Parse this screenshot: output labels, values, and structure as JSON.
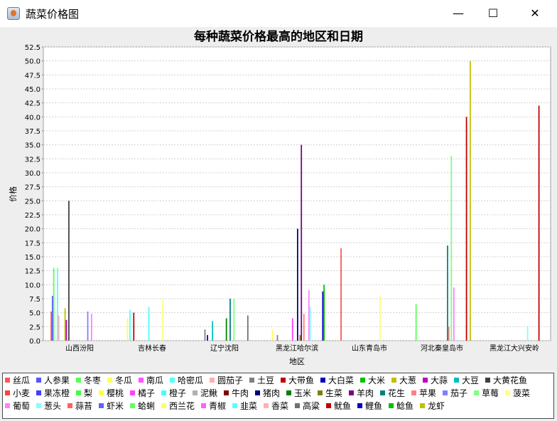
{
  "window": {
    "title": "蔬菜价格图",
    "minimize_symbol": "—",
    "maximize_symbol": "☐",
    "close_symbol": "✕"
  },
  "chart_data": {
    "type": "bar",
    "title": "每种蔬菜价格最高的地区和日期",
    "xlabel": "地区",
    "ylabel": "价格",
    "ylim": [
      0,
      52.5
    ],
    "ytick_step": 2.5,
    "grid": true,
    "legend_position": "bottom",
    "categories": [
      "山西汾阳",
      "吉林长春",
      "辽宁沈阳",
      "黑龙江哈尔滨",
      "山东青岛市",
      "河北秦皇岛市",
      "黑龙江大兴安岭"
    ],
    "series": [
      {
        "name": "丝瓜",
        "color": "#ff5555",
        "values": [
          5.2,
          null,
          null,
          null,
          16.5,
          null,
          null
        ]
      },
      {
        "name": "人参果",
        "color": "#5555ff",
        "values": [
          8.0,
          null,
          null,
          null,
          null,
          null,
          null
        ]
      },
      {
        "name": "冬枣",
        "color": "#55ff55",
        "values": [
          13.0,
          null,
          null,
          null,
          null,
          6.5,
          null
        ]
      },
      {
        "name": "冬瓜",
        "color": "#ffff55",
        "values": [
          null,
          4.0,
          null,
          2.0,
          null,
          null,
          null
        ]
      },
      {
        "name": "南瓜",
        "color": "#ff55ff",
        "values": [
          null,
          null,
          null,
          null,
          null,
          null,
          null
        ]
      },
      {
        "name": "哈密瓜",
        "color": "#55ffff",
        "values": [
          13.0,
          5.5,
          null,
          null,
          null,
          null,
          null
        ]
      },
      {
        "name": "圆茄子",
        "color": "#ffafaf",
        "values": [
          4.5,
          null,
          null,
          null,
          null,
          null,
          null
        ]
      },
      {
        "name": "土豆",
        "color": "#808080",
        "values": [
          null,
          null,
          2.0,
          1.0,
          null,
          null,
          null
        ]
      },
      {
        "name": "大带鱼",
        "color": "#c00000",
        "values": [
          null,
          5.0,
          null,
          null,
          null,
          null,
          null
        ]
      },
      {
        "name": "大白菜",
        "color": "#0000c0",
        "values": [
          null,
          null,
          1.0,
          null,
          null,
          null,
          null
        ]
      },
      {
        "name": "大米",
        "color": "#00c000",
        "values": [
          null,
          null,
          null,
          null,
          null,
          null,
          null
        ]
      },
      {
        "name": "大葱",
        "color": "#c0c000",
        "values": [
          5.8,
          null,
          null,
          null,
          null,
          null,
          null
        ]
      },
      {
        "name": "大蒜",
        "color": "#c000c0",
        "values": [
          3.7,
          null,
          null,
          null,
          null,
          null,
          null
        ]
      },
      {
        "name": "大豆",
        "color": "#00c0c0",
        "values": [
          null,
          null,
          3.5,
          null,
          null,
          null,
          null
        ]
      },
      {
        "name": "大黄花鱼",
        "color": "#404040",
        "values": [
          25.0,
          null,
          null,
          null,
          null,
          null,
          null
        ]
      },
      {
        "name": "小麦",
        "color": "#ff4040",
        "values": [
          null,
          null,
          null,
          null,
          null,
          null,
          null
        ]
      },
      {
        "name": "果冻橙",
        "color": "#4040ff",
        "values": [
          null,
          null,
          null,
          null,
          null,
          null,
          null
        ]
      },
      {
        "name": "梨",
        "color": "#40ff40",
        "values": [
          null,
          null,
          null,
          null,
          null,
          null,
          null
        ]
      },
      {
        "name": "樱桃",
        "color": "#ffff40",
        "values": [
          null,
          null,
          null,
          null,
          null,
          null,
          null
        ]
      },
      {
        "name": "橘子",
        "color": "#ff40ff",
        "values": [
          null,
          null,
          null,
          4.0,
          null,
          null,
          null
        ]
      },
      {
        "name": "橙子",
        "color": "#40ffff",
        "values": [
          null,
          6.0,
          null,
          null,
          null,
          null,
          null
        ]
      },
      {
        "name": "泥鳅",
        "color": "#b0b0b0",
        "values": [
          null,
          null,
          null,
          null,
          null,
          null,
          null
        ]
      },
      {
        "name": "牛肉",
        "color": "#800000",
        "values": [
          null,
          null,
          null,
          null,
          null,
          null,
          null
        ]
      },
      {
        "name": "猪肉",
        "color": "#000080",
        "values": [
          null,
          null,
          null,
          20.0,
          null,
          null,
          null
        ]
      },
      {
        "name": "玉米",
        "color": "#008000",
        "values": [
          null,
          null,
          4.0,
          null,
          null,
          null,
          null
        ]
      },
      {
        "name": "生菜",
        "color": "#808000",
        "values": [
          null,
          null,
          null,
          1.0,
          null,
          null,
          null
        ]
      },
      {
        "name": "羊肉",
        "color": "#800080",
        "values": [
          null,
          null,
          null,
          35.0,
          null,
          null,
          null
        ]
      },
      {
        "name": "花生",
        "color": "#008080",
        "values": [
          null,
          null,
          7.5,
          null,
          null,
          17.0,
          null
        ]
      },
      {
        "name": "苹果",
        "color": "#ff8080",
        "values": [
          null,
          null,
          null,
          4.8,
          null,
          2.5,
          null
        ]
      },
      {
        "name": "茄子",
        "color": "#8080ff",
        "values": [
          5.2,
          null,
          null,
          null,
          null,
          null,
          null
        ]
      },
      {
        "name": "草莓",
        "color": "#80ff80",
        "values": [
          null,
          null,
          7.5,
          null,
          null,
          33.0,
          null
        ]
      },
      {
        "name": "菠菜",
        "color": "#ffff80",
        "values": [
          null,
          7.5,
          null,
          null,
          8.0,
          null,
          null
        ]
      },
      {
        "name": "葡萄",
        "color": "#ff80ff",
        "values": [
          4.8,
          null,
          null,
          9.0,
          null,
          9.5,
          null
        ]
      },
      {
        "name": "葱头",
        "color": "#80ffff",
        "values": [
          null,
          null,
          null,
          6.0,
          null,
          null,
          2.5
        ]
      },
      {
        "name": "蒜苔",
        "color": "#ff6060",
        "values": [
          null,
          null,
          null,
          null,
          null,
          null,
          null
        ]
      },
      {
        "name": "虾米",
        "color": "#6060ff",
        "values": [
          null,
          null,
          null,
          null,
          null,
          null,
          null
        ]
      },
      {
        "name": "蛤蜊",
        "color": "#60ff60",
        "values": [
          null,
          null,
          null,
          null,
          null,
          null,
          null
        ]
      },
      {
        "name": "西兰花",
        "color": "#ffff60",
        "values": [
          null,
          null,
          null,
          null,
          null,
          null,
          null
        ]
      },
      {
        "name": "青椒",
        "color": "#ff60ff",
        "values": [
          null,
          null,
          null,
          null,
          null,
          null,
          null
        ]
      },
      {
        "name": "韭菜",
        "color": "#60ffff",
        "values": [
          null,
          null,
          null,
          null,
          null,
          null,
          null
        ]
      },
      {
        "name": "香菜",
        "color": "#ffb0b0",
        "values": [
          null,
          null,
          null,
          null,
          null,
          null,
          null
        ]
      },
      {
        "name": "高粱",
        "color": "#707070",
        "values": [
          null,
          null,
          4.5,
          null,
          null,
          null,
          null
        ]
      },
      {
        "name": "鱿鱼",
        "color": "#c00000",
        "values": [
          null,
          null,
          null,
          null,
          null,
          40.0,
          42.0
        ]
      },
      {
        "name": "鲤鱼",
        "color": "#0000c0",
        "values": [
          null,
          null,
          null,
          8.8,
          null,
          null,
          null
        ]
      },
      {
        "name": "鲶鱼",
        "color": "#00c000",
        "values": [
          null,
          null,
          null,
          10.0,
          null,
          null,
          null
        ]
      },
      {
        "name": "龙虾",
        "color": "#c0c000",
        "values": [
          null,
          null,
          null,
          null,
          null,
          50.0,
          null
        ]
      }
    ]
  }
}
